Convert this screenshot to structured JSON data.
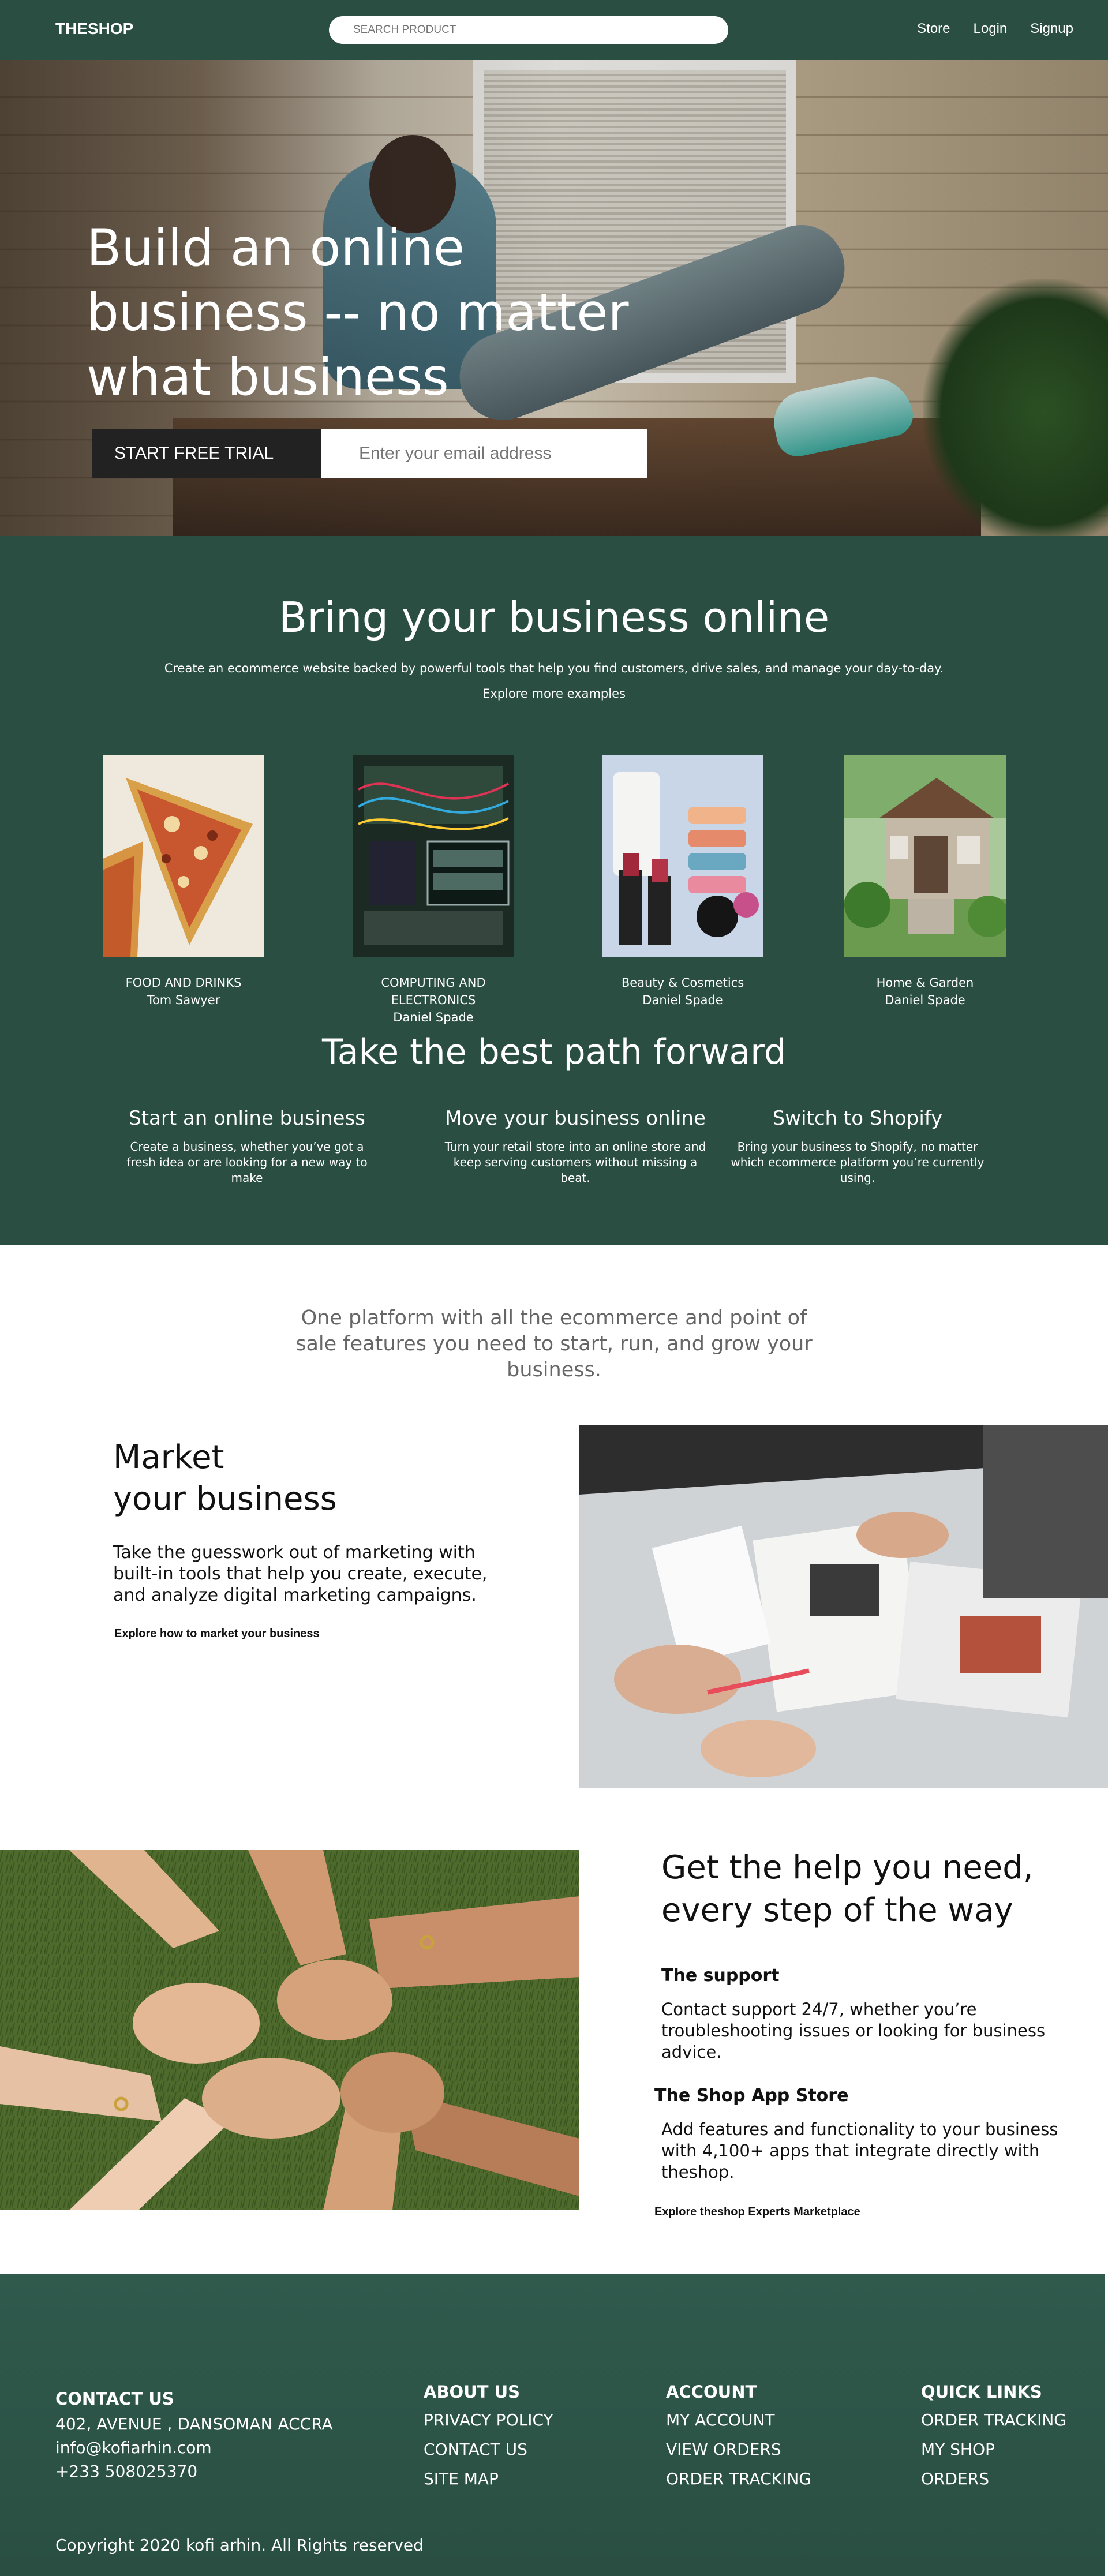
{
  "header": {
    "logo": "THESHOP",
    "search_placeholder": "SEARCH PRODUCT",
    "nav": [
      "Store",
      "Login",
      "Signup"
    ]
  },
  "hero": {
    "title": "Build an online\nbusiness  -- no matter\nwhat business",
    "cta_button": "START FREE TRIAL",
    "email_placeholder": "Enter your email address"
  },
  "bring": {
    "title": "Bring your business online",
    "subtitle": "Create an ecommerce website backed by powerful tools that help you find customers, drive sales, and manage your day-to-day.",
    "link": "Explore more examples",
    "categories": [
      {
        "name": "FOOD AND DRINKS",
        "author": "Tom Sawyer"
      },
      {
        "name": "COMPUTING AND ELECTRONICS",
        "author": "Daniel Spade"
      },
      {
        "name": "Beauty & Cosmetics",
        "author": "Daniel Spade"
      },
      {
        "name": "Home & Garden",
        "author": "Daniel Spade"
      }
    ]
  },
  "path": {
    "title": "Take the best path forward",
    "columns": [
      {
        "title": "Start an online business",
        "text": "Create a business, whether you’ve got a fresh idea or are looking for a new way to make"
      },
      {
        "title": "Move your business online",
        "text": "Turn your retail store into an online store and keep serving customers without missing a beat."
      },
      {
        "title": "Switch to Shopify",
        "text": "Bring your business to Shopify, no matter which ecommerce platform you’re currently using."
      }
    ]
  },
  "platform": {
    "text": "One platform with all the ecommerce and point of sale features you need to start, run, and grow your business."
  },
  "market": {
    "title": "Market\nyour business",
    "text": "Take the guesswork out of marketing with built-in tools that help you create, execute, and analyze digital marketing campaigns.",
    "link": "Explore how to market your business"
  },
  "help": {
    "title": "Get the help you need,\nevery step of the way",
    "support_title": "The support",
    "support_text": "Contact support 24/7, whether you’re troubleshooting issues or looking for business advice.",
    "appstore_title": "The Shop App Store",
    "appstore_text": "Add features and functionality to your business with 4,100+ apps that integrate directly with theshop.",
    "link": "Explore theshop Experts Marketplace"
  },
  "footer": {
    "contact": {
      "title": "CONTACT US",
      "lines": [
        "402, AVENUE , DANSOMAN ACCRA",
        "info@kofiarhin.com",
        "+233 508025370"
      ]
    },
    "about": {
      "title": "ABOUT US",
      "links": [
        "PRIVACY POLICY",
        "CONTACT US",
        "SITE MAP"
      ]
    },
    "account": {
      "title": "ACCOUNT",
      "links": [
        "MY ACCOUNT",
        "VIEW ORDERS",
        "ORDER TRACKING"
      ]
    },
    "quick": {
      "title": "QUICK LINKS",
      "links": [
        "ORDER TRACKING",
        "MY SHOP",
        "ORDERS"
      ]
    },
    "copyright": "Copyright 2020 kofi arhin. All Rights reserved"
  },
  "colors": {
    "brand_green": "#2a4e42",
    "hero_button": "#222222",
    "muted_text": "#666666"
  }
}
